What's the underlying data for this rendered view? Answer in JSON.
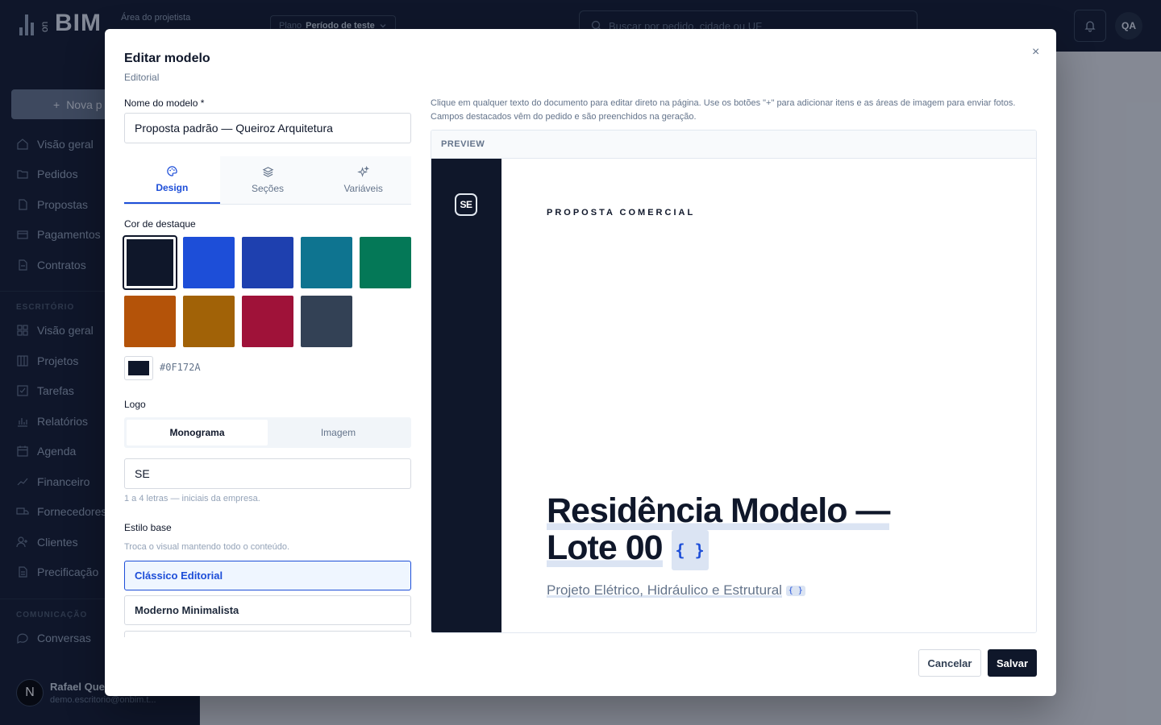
{
  "topbar": {
    "brand_on": "on",
    "brand_name": "BIM",
    "area_label": "Área do projetista",
    "plan_label": "Plano",
    "plan_value": "Período de teste",
    "search_placeholder": "Buscar por pedido, cidade ou UF",
    "avatar_initials": "QA"
  },
  "sidebar": {
    "new_button": "Nova p",
    "items_main": [
      "Visão geral",
      "Pedidos",
      "Propostas",
      "Pagamentos",
      "Contratos"
    ],
    "section_office": "ESCRITÓRIO",
    "items_office": [
      "Visão geral",
      "Projetos",
      "Tarefas",
      "Relatórios",
      "Agenda",
      "Financeiro",
      "Fornecedores",
      "Clientes",
      "Precificação"
    ],
    "section_comm": "COMUNICAÇÃO",
    "items_comm": [
      "Conversas"
    ],
    "user_initial": "N",
    "user_name": "Rafael Quei",
    "user_email": "demo.escritorio@onbim.t..."
  },
  "modal": {
    "title": "Editar modelo",
    "subtitle": "Editorial",
    "close": "×",
    "name_label": "Nome do modelo *",
    "name_value": "Proposta padrão — Queiroz Arquitetura",
    "tabs": [
      {
        "label": "Design",
        "icon": "palette-icon",
        "active": true
      },
      {
        "label": "Seções",
        "icon": "layers-icon",
        "active": false
      },
      {
        "label": "Variáveis",
        "icon": "sparkles-icon",
        "active": false
      }
    ],
    "accent_label": "Cor de destaque",
    "swatches": [
      "#0F172A",
      "#1D4ED8",
      "#1E40AF",
      "#0E7490",
      "#047857",
      "#B45309",
      "#A16207",
      "#9F1239",
      "#334155"
    ],
    "selected_swatch": "#0F172A",
    "hex_value": "#0F172A",
    "logo_label": "Logo",
    "logo_modes": [
      "Monograma",
      "Imagem"
    ],
    "logo_mode_selected": "Monograma",
    "monogram_value": "SE",
    "monogram_hint": "1 a 4 letras — iniciais da empresa.",
    "style_label": "Estilo base",
    "style_hint": "Troca o visual mantendo todo o conteúdo.",
    "styles": [
      "Clássico Editorial",
      "Moderno Minimalista"
    ],
    "style_selected": "Clássico Editorial",
    "cancel": "Cancelar",
    "save": "Salvar"
  },
  "preview": {
    "note": "Clique em qualquer texto do documento para editar direto na página. Use os botões \"+\" para adicionar itens e as áreas de imagem para enviar fotos. Campos destacados vêm do pedido e são preenchidos na geração.",
    "header": "PREVIEW",
    "monogram": "SE",
    "kicker": "PROPOSTA COMERCIAL",
    "title_line1": "Residência Modelo —",
    "title_line2": "Lote 00",
    "var_tag": "{ }",
    "subtitle": "Projeto Elétrico, Hidráulico e Estrutural",
    "band_color": "#0F172A"
  }
}
